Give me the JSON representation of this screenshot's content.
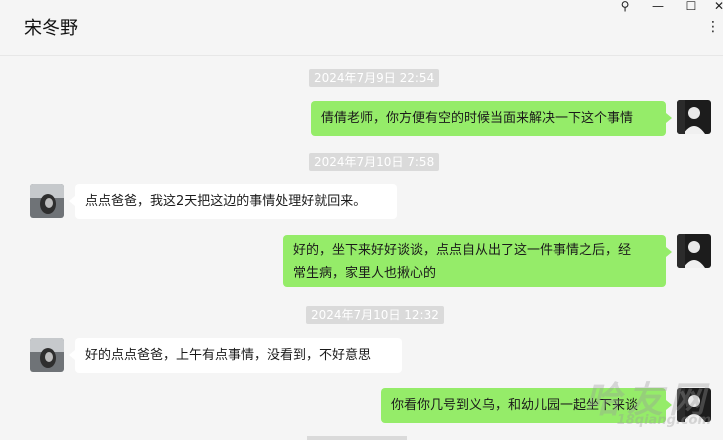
{
  "header": {
    "title": "宋冬野"
  },
  "window_controls": {
    "pin": "⚲",
    "minimize": "—",
    "maximize": "☐",
    "close": "✕",
    "more": "⋮"
  },
  "messages": [
    {
      "type": "time",
      "text": "2024年7月9日 22:54"
    },
    {
      "type": "msg",
      "from": "me",
      "text": "倩倩老师，你方便有空的时候当面来解决一下这个事情"
    },
    {
      "type": "time",
      "text": "2024年7月10日 7:58"
    },
    {
      "type": "msg",
      "from": "them",
      "text": "点点爸爸，我这2天把这边的事情处理好就回来。"
    },
    {
      "type": "msg",
      "from": "me",
      "lines": [
        "好的，坐下来好好谈谈，点点自从出了这一件事情之后，经",
        "常生病，家里人也揪心的"
      ]
    },
    {
      "type": "time",
      "text": "2024年7月10日 12:32"
    },
    {
      "type": "msg",
      "from": "them",
      "text": "好的点点爸爸，上午有点事情，没看到，不好意思"
    },
    {
      "type": "msg",
      "from": "me",
      "text": "你看你几号到义乌，和幼儿园一起坐下来谈"
    }
  ],
  "watermark": {
    "main": "哈友网",
    "site": "18qiang.com"
  },
  "colors": {
    "self_bubble": "#95ec69",
    "other_bubble": "#ffffff",
    "background": "#f5f5f5",
    "timestamp_bg": "#dadada"
  }
}
